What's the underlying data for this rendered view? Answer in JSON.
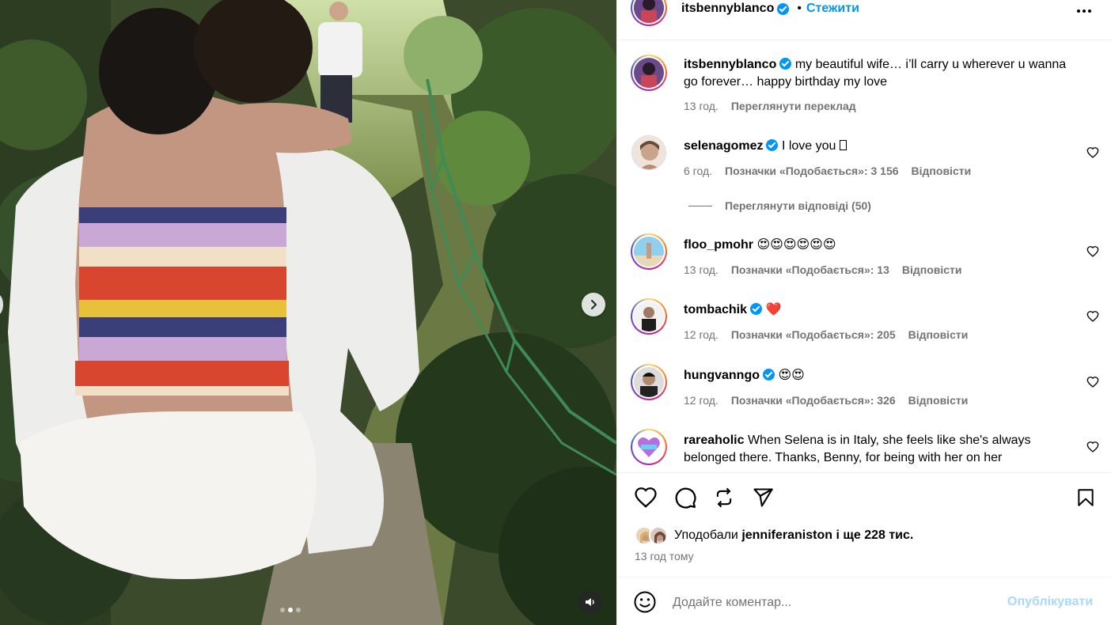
{
  "header": {
    "username": "itsbennyblanco",
    "separator": "•",
    "follow_label": "Стежити"
  },
  "caption": {
    "username": "itsbennyblanco",
    "text": "my beautiful wife… i’ll carry u wherever u wanna go forever… happy birthday my love",
    "time": "13 год.",
    "translate_label": "Переглянути переклад"
  },
  "comments": [
    {
      "username": "selenagomez",
      "verified": true,
      "text": "I love you ",
      "time": "6 год.",
      "likes": "Позначки «Подобається»: 3 156",
      "reply_label": "Відповісти"
    },
    {
      "username": "floo_pmohr",
      "verified": false,
      "text": "😍😍😍😍😍😍",
      "time": "13 год.",
      "likes": "Позначки «Подобається»: 13",
      "reply_label": "Відповісти"
    },
    {
      "username": "tombachik",
      "verified": true,
      "text": "❤️",
      "time": "12 год.",
      "likes": "Позначки «Подобається»: 205",
      "reply_label": "Відповісти"
    },
    {
      "username": "hungvanngo",
      "verified": true,
      "text": "😍😍",
      "time": "12 год.",
      "likes": "Позначки «Подобається»: 326",
      "reply_label": "Відповісти"
    },
    {
      "username": "rareaholic",
      "verified": false,
      "text": "When Selena is in Italy, she feels like she's always belonged there. Thanks, Benny, for being with her on her"
    }
  ],
  "view_replies_label": "Переглянути відповіді (50)",
  "likes_summary": {
    "prefix": "Уподобали",
    "user": "jenniferaniston",
    "middle": "і",
    "rest": "ще 228 тис."
  },
  "post_time": "13 год тому",
  "add_comment": {
    "placeholder": "Додайте коментар...",
    "publish_label": "Опублікувати"
  },
  "media": {
    "slide_count": 3,
    "active_slide": 2
  },
  "colors": {
    "accent": "#0095f6",
    "publish_disabled": "#a8d8fc",
    "secondary_text": "#737373",
    "divider": "#efefef"
  },
  "icons": {
    "like": "heart-icon",
    "comment": "comment-icon",
    "repost": "repost-icon",
    "share": "send-icon",
    "save": "bookmark-icon",
    "emoji": "smiley-icon",
    "audio": "speaker-icon",
    "next": "chevron-right-icon",
    "options": "more-options-icon"
  }
}
